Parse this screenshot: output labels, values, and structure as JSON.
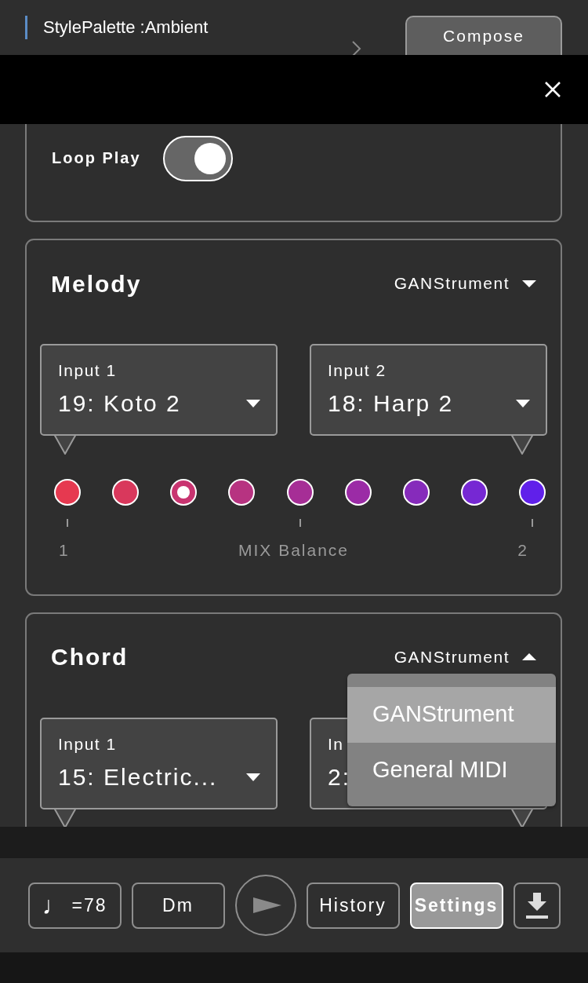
{
  "header": {
    "style_label": "StylePalette :Ambient",
    "compose_button": "Compose"
  },
  "loop_play": {
    "label": "Loop Play",
    "on": true
  },
  "sections": [
    {
      "title": "Melody",
      "source": "GANStrument",
      "expanded": false,
      "inputs": [
        {
          "label": "Input 1",
          "value": "19: Koto 2"
        },
        {
          "label": "Input 2",
          "value": "18: Harp 2"
        }
      ],
      "mix": {
        "dots": [
          {
            "color": "#e63950",
            "selected": false
          },
          {
            "color": "#d9385c",
            "selected": false
          },
          {
            "color": "#c83470",
            "selected": true
          },
          {
            "color": "#b73381",
            "selected": false
          },
          {
            "color": "#a62e96",
            "selected": false
          },
          {
            "color": "#9b2ba6",
            "selected": false
          },
          {
            "color": "#862bbb",
            "selected": false
          },
          {
            "color": "#7628d3",
            "selected": false
          },
          {
            "color": "#6020ea",
            "selected": false
          }
        ],
        "left_label": "1",
        "center_label": "MIX Balance",
        "right_label": "2"
      }
    },
    {
      "title": "Chord",
      "source": "GANStrument",
      "expanded": true,
      "inputs": [
        {
          "label": "Input 1",
          "value": "15: Electric..."
        },
        {
          "label": "In",
          "value": "2:"
        }
      ],
      "menu": [
        {
          "label": "GANStrument",
          "selected": true
        },
        {
          "label": "General MIDI",
          "selected": false
        }
      ]
    }
  ],
  "toolbar": [
    {
      "kind": "tempo",
      "note": "♩",
      "label": "=78",
      "selected": false
    },
    {
      "kind": "text",
      "label": "Dm",
      "selected": false
    },
    {
      "kind": "play",
      "selected": false
    },
    {
      "kind": "text",
      "label": "History",
      "selected": false
    },
    {
      "kind": "text",
      "label": "Settings",
      "selected": true
    },
    {
      "kind": "download",
      "selected": false
    }
  ]
}
